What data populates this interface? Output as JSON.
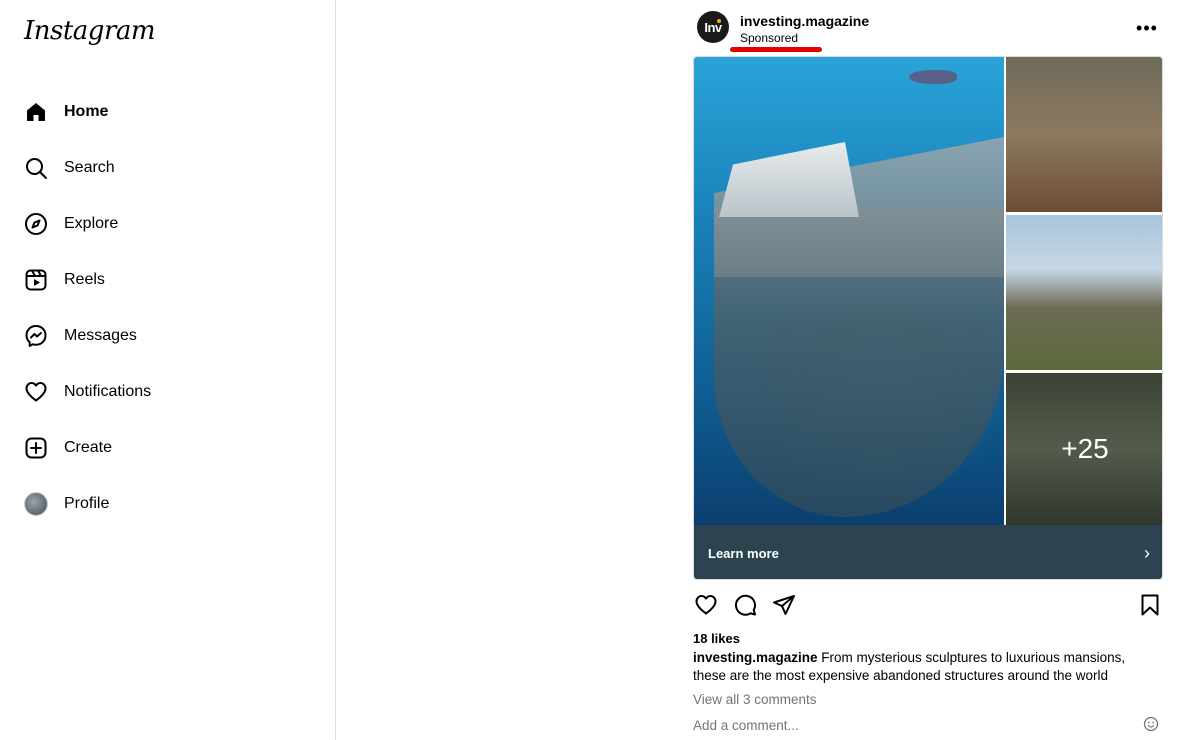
{
  "app": {
    "logo_text": "Instagram"
  },
  "sidebar": {
    "items": [
      {
        "label": "Home",
        "icon": "home-icon",
        "active": true
      },
      {
        "label": "Search",
        "icon": "search-icon"
      },
      {
        "label": "Explore",
        "icon": "compass-icon"
      },
      {
        "label": "Reels",
        "icon": "reels-icon"
      },
      {
        "label": "Messages",
        "icon": "messenger-icon"
      },
      {
        "label": "Notifications",
        "icon": "heart-icon"
      },
      {
        "label": "Create",
        "icon": "plus-square-icon"
      },
      {
        "label": "Profile",
        "icon": "avatar"
      }
    ]
  },
  "post": {
    "avatar_text": "Inv",
    "username": "investing.magazine",
    "sponsored_label": "Sponsored",
    "more_label": "•••",
    "extra_images_label": "+25",
    "cta_label": "Learn more",
    "cta_chevron": "›",
    "likes": "18 likes",
    "caption_user": "investing.magazine",
    "caption_text": " From mysterious sculptures to luxurious mansions, these are the most expensive abandoned structures around the world",
    "view_comments": "View all 3 comments",
    "add_comment_placeholder": "Add a comment...",
    "accent_underline": "#e60000"
  }
}
